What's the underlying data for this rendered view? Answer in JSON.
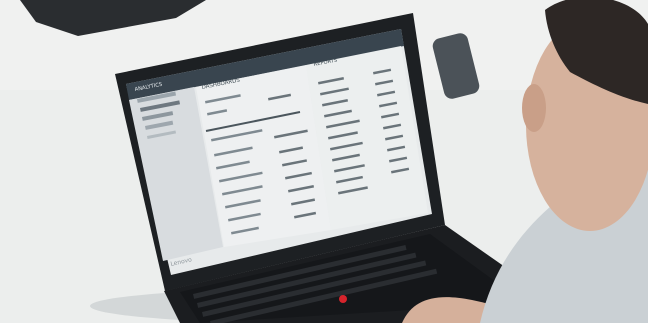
{
  "photo": {
    "subject": "person using laptop",
    "colors": {
      "wall": "#f6f7f6",
      "desk": "#e7e8e6",
      "laptop_body": "#1e2124",
      "screen_bg": "#e5e8ea",
      "sidebar_bg": "#d9dde0",
      "screen_header": "#3a4650",
      "accent_red": "#d6242c",
      "skin": "#d7b19b",
      "hair": "#2d2725",
      "shirt": "#c9cfd3"
    }
  },
  "screen": {
    "brand": "ANALYTICS",
    "section_left": "DASHBOARDS",
    "section_right": "REPORTS",
    "laptop_brand": "Lenovo"
  }
}
